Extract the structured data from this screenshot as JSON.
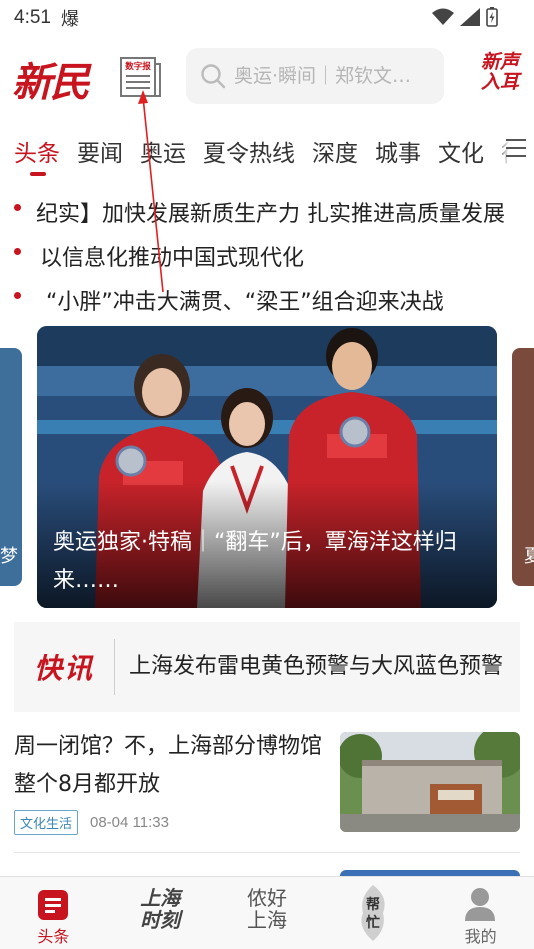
{
  "status_bar": {
    "time": "4:51",
    "notification_glyph": "爆"
  },
  "header": {
    "logo_text": "新民",
    "digital_paper_label": "数字报",
    "search_placeholder": "奥运·瞬间｜郑钦文…",
    "audio_logo_line1": "新声",
    "audio_logo_line2": "入耳"
  },
  "tabs": [
    "头条",
    "要闻",
    "奥运",
    "夏令热线",
    "深度",
    "城事",
    "文化",
    "行"
  ],
  "headlines": [
    "纪实】加快发展新质生产力 扎实推进高质量发展",
    "以信息化推动中国式现代化",
    "“小胖”冲击大满贯、“梁王”组合迎来决战"
  ],
  "carousel": {
    "left_peek_text": "梦",
    "right_peek_text": "夏",
    "main_caption": "奥运独家·特稿｜“翻车”后，覃海洋这样归来……"
  },
  "flash_news": {
    "label": "快讯",
    "text": "上海发布雷电黄色预警与大风蓝色预警"
  },
  "article": {
    "title": "周一闭馆？不，上海部分博物馆整个8月都开放",
    "tag": "文化生活",
    "time": "08-04 11:33"
  },
  "bottom_nav": {
    "items": [
      {
        "label": "头条",
        "active": true
      },
      {
        "label": "上海时刻",
        "line1": "上海",
        "line2": "时刻"
      },
      {
        "label": "侬好上海",
        "line1": "侬好",
        "line2": "上海"
      },
      {
        "label": "帮忙"
      },
      {
        "label": "我的"
      }
    ]
  },
  "colors": {
    "brand_red": "#c8141e",
    "tag_blue": "#3b86b8",
    "nav_bg": "#f8f8f8"
  }
}
